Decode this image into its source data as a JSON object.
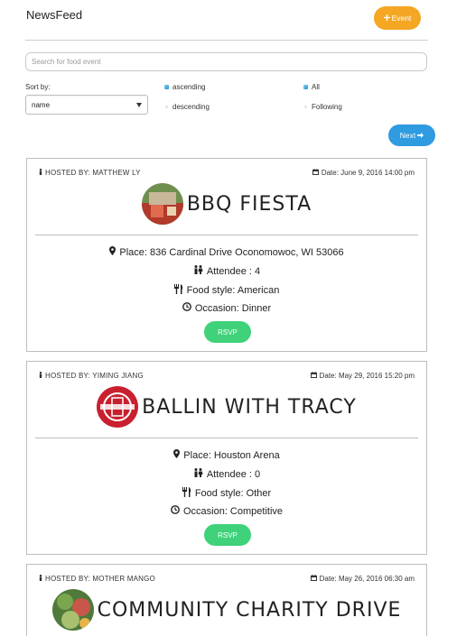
{
  "header": {
    "title": "NewsFeed",
    "event_button": "Event"
  },
  "search": {
    "placeholder": "Search for food event",
    "value": ""
  },
  "sort": {
    "label": "Sort by:",
    "selected": "name",
    "order_options": [
      "ascending",
      "descending"
    ],
    "order_selected": "ascending",
    "scope_options": [
      "All",
      "Following"
    ],
    "scope_selected": "All"
  },
  "pagination": {
    "next_label": "Next"
  },
  "colors": {
    "event_button": "#f5a623",
    "next_button": "#2f9be0",
    "rsvp_button": "#3fd27a"
  },
  "events": [
    {
      "host": "HOSTED BY: MATTHEW LY",
      "date": "Date: June 9, 2016 14:00 pm",
      "title": "BBQ FIESTA",
      "place": "Place: 836 Cardinal Drive Oconomowoc, WI 53066",
      "attendee": "Attendee : 4",
      "food_style": "Food style: American",
      "occasion": "Occasion: Dinner",
      "rsvp": "RSVP"
    },
    {
      "host": "HOSTED BY: YIMING JIANG",
      "date": "Date: May 29, 2016 15:20 pm",
      "title": "BALLIN WITH TRACY",
      "place": "Place: Houston Arena",
      "attendee": "Attendee : 0",
      "food_style": "Food style: Other",
      "occasion": "Occasion: Competitive",
      "rsvp": "RSVP"
    },
    {
      "host": "HOSTED BY: MOTHER MANGO",
      "date": "Date: May 26, 2016 06:30 am",
      "title": "COMMUNITY CHARITY DRIVE"
    }
  ]
}
